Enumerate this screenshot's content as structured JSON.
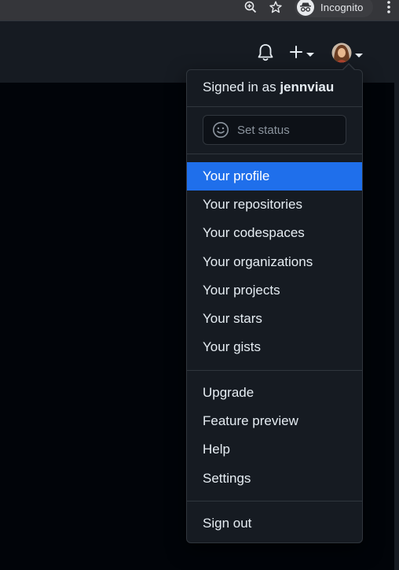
{
  "browser": {
    "zoom_icon": "zoom-in-icon",
    "star_icon": "star-icon",
    "incognito_label": "Incognito",
    "menu_icon": "kebab-menu-icon"
  },
  "header": {
    "notifications_icon": "bell-icon",
    "create_icon": "plus-icon",
    "avatar_alt": "avatar"
  },
  "dropdown": {
    "signed_in_prefix": "Signed in as",
    "username": "jennviau",
    "set_status_label": "Set status",
    "menu_group_1": [
      {
        "label": "Your profile",
        "active": true
      },
      {
        "label": "Your repositories"
      },
      {
        "label": "Your codespaces"
      },
      {
        "label": "Your organizations"
      },
      {
        "label": "Your projects"
      },
      {
        "label": "Your stars"
      },
      {
        "label": "Your gists"
      }
    ],
    "menu_group_2": [
      {
        "label": "Upgrade"
      },
      {
        "label": "Feature preview"
      },
      {
        "label": "Help"
      },
      {
        "label": "Settings"
      }
    ],
    "sign_out_label": "Sign out"
  },
  "colors": {
    "accent": "#1f6feb",
    "background": "#010409",
    "header_bg": "#161b22",
    "menu_bg": "#161b22",
    "border": "#30363d"
  }
}
